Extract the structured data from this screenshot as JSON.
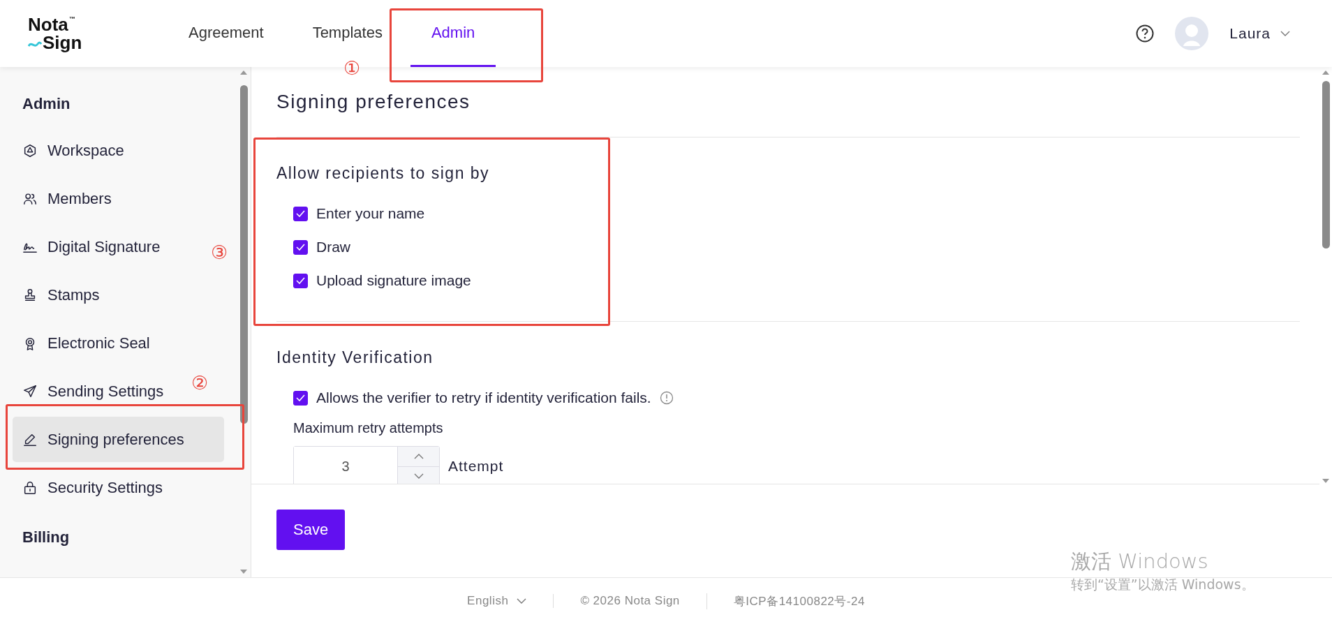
{
  "header": {
    "logo": {
      "line1": "Nota",
      "mark": "™",
      "line2": "Sign"
    },
    "tabs": [
      {
        "label": "Agreement",
        "selected": false
      },
      {
        "label": "Templates",
        "selected": false
      },
      {
        "label": "Admin",
        "selected": true
      }
    ],
    "user": {
      "name": "Laura"
    }
  },
  "sidebar": {
    "groups": [
      {
        "title": "Admin",
        "items": [
          {
            "label": "Workspace",
            "selected": false
          },
          {
            "label": "Members",
            "selected": false
          },
          {
            "label": "Digital Signature",
            "selected": false
          },
          {
            "label": "Stamps",
            "selected": false
          },
          {
            "label": "Electronic Seal",
            "selected": false
          },
          {
            "label": "Sending Settings",
            "selected": false
          },
          {
            "label": "Signing preferences",
            "selected": true
          },
          {
            "label": "Security Settings",
            "selected": false
          }
        ]
      },
      {
        "title": "Billing"
      }
    ]
  },
  "page": {
    "title": "Signing preferences",
    "sections": [
      {
        "title": "Allow recipients to sign by",
        "options": [
          {
            "label": "Enter your name",
            "checked": true
          },
          {
            "label": "Draw",
            "checked": true
          },
          {
            "label": "Upload signature image",
            "checked": true
          }
        ]
      },
      {
        "title": "Identity Verification",
        "options": [
          {
            "label": "Allows the verifier to retry if identity verification fails.",
            "checked": true,
            "info": true
          }
        ],
        "field": {
          "label": "Maximum retry attempts",
          "value": "3",
          "unit": "Attempt"
        }
      }
    ],
    "save": "Save"
  },
  "footer": {
    "language": "English",
    "copyright": "© 2026 Nota Sign",
    "icp": "粤ICP备14100822号-24"
  },
  "os_notice": {
    "title": "激活 Windows",
    "text": "转到“设置”以激活 Windows。"
  },
  "annotations": [
    "①",
    "②",
    "③"
  ]
}
